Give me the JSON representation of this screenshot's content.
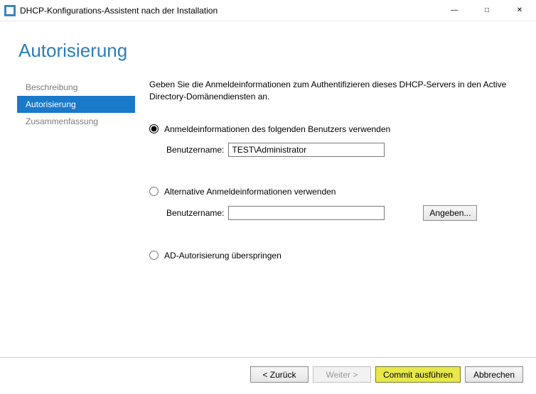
{
  "window": {
    "title": "DHCP-Konfigurations-Assistent nach der Installation"
  },
  "heading": "Autorisierung",
  "sidebar": {
    "items": [
      {
        "label": "Beschreibung"
      },
      {
        "label": "Autorisierung"
      },
      {
        "label": "Zusammenfassung"
      }
    ],
    "active_index": 1
  },
  "main": {
    "instructions": "Geben Sie die Anmeldeinformationen zum Authentifizieren dieses DHCP-Servers in den Active Directory-Domänendiensten an.",
    "option1": {
      "label": "Anmeldeinformationen des folgenden Benutzers verwenden",
      "username_label": "Benutzername:",
      "username_value": "TEST\\Administrator",
      "selected": true
    },
    "option2": {
      "label": "Alternative Anmeldeinformationen verwenden",
      "username_label": "Benutzername:",
      "username_value": "",
      "specify_label": "Angeben...",
      "selected": false
    },
    "option3": {
      "label": "AD-Autorisierung überspringen",
      "selected": false
    }
  },
  "buttons": {
    "back": "< Zurück",
    "next": "Weiter >",
    "commit": "Commit ausführen",
    "cancel": "Abbrechen"
  }
}
